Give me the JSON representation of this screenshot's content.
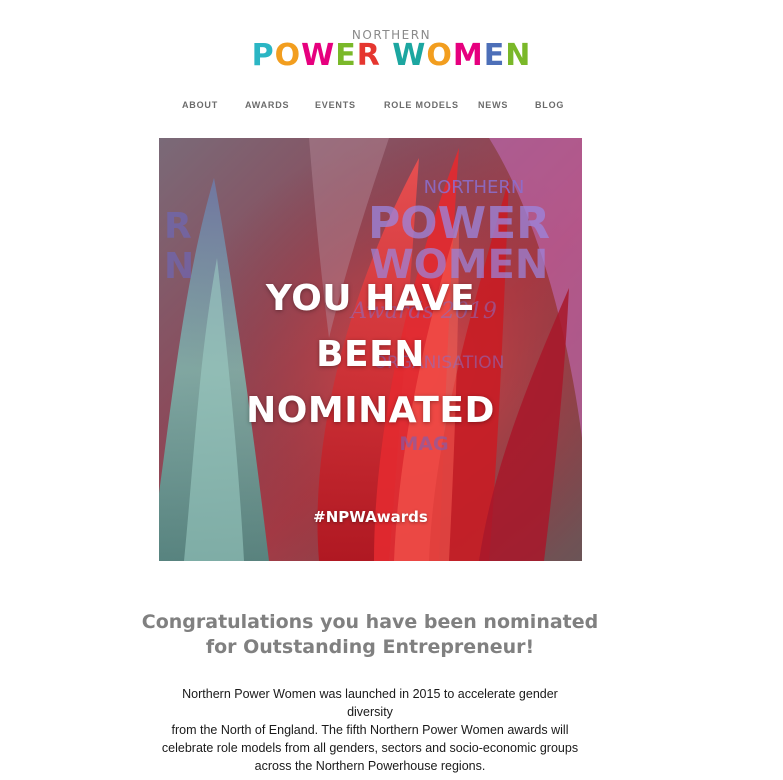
{
  "logo": {
    "line1": "NORTHERN",
    "line2_letters": [
      "P",
      "O",
      "W",
      "E",
      "R",
      " ",
      "W",
      "O",
      "M",
      "E",
      "N"
    ],
    "line2_colors": [
      "#2bb6c4",
      "#f29e1f",
      "#e6007e",
      "#7ab829",
      "#e5362f",
      "#ffffff",
      "#1ca6a0",
      "#f29e1f",
      "#e6007e",
      "#4d6fb8",
      "#7ab829"
    ]
  },
  "nav": {
    "items": [
      "ABOUT",
      "AWARDS",
      "EVENTS",
      "ROLE MODELS",
      "NEWS",
      "BLOG"
    ]
  },
  "hero": {
    "title_lines": [
      "YOU HAVE",
      "BEEN",
      "NOMINATED"
    ],
    "hashtag": "#NPWAwards",
    "trophy_text": [
      "NORTHERN",
      "POWER",
      "WOMEN",
      "Awards 2019",
      "ORGANISATION",
      "MAG"
    ]
  },
  "headline": {
    "line1": "Congratulations you have been nominated",
    "line2": "for Outstanding Entrepreneur!"
  },
  "body": {
    "lines": [
      "Northern Power Women was launched in 2015 to accelerate gender diversity",
      "from the North of England. The fifth Northern Power Women awards will",
      "celebrate role models from all genders, sectors and socio-economic groups",
      "across the Northern Powerhouse regions."
    ]
  },
  "colors": {
    "nav_text": "#6b6b6b",
    "headline_text": "#808080",
    "body_text": "#1a1a1a",
    "trophy_red": "#d8262b",
    "background": "#ffffff"
  }
}
